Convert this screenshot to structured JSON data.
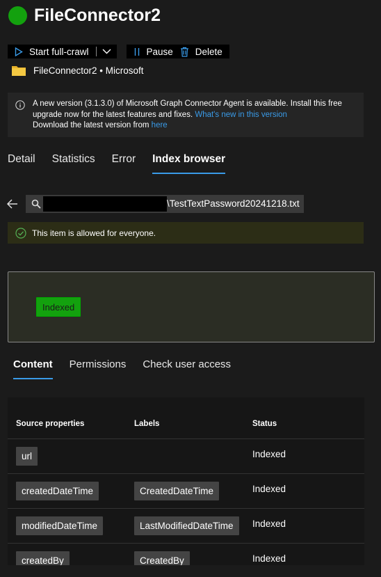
{
  "header": {
    "title": "FileConnector2",
    "status_color": "#13a10e"
  },
  "toolbar": {
    "start_label": "Start full-crawl",
    "pause_label": "Pause",
    "delete_label": "Delete"
  },
  "owner": {
    "text": "FileConnector2 • Microsoft",
    "icon": "folder-icon"
  },
  "banner": {
    "line1": "A new version (3.1.3.0) of Microsoft Graph Connector Agent is available. Install this free upgrade now for the latest features and fixes.",
    "whats_new_link": "What's new in this version",
    "download_text": "Download the latest version from",
    "here_link": "here"
  },
  "tabs": [
    "Detail",
    "Statistics",
    "Error",
    "Index browser"
  ],
  "active_tab": "Index browser",
  "search": {
    "value": "\\TestTextPassword20241218.txt"
  },
  "allowed": {
    "text": "This item is allowed for everyone."
  },
  "index_status": {
    "label": "Indexed"
  },
  "subtabs": [
    "Content",
    "Permissions",
    "Check user access"
  ],
  "table": {
    "headers": [
      "Source properties",
      "Labels",
      "Status"
    ],
    "rows": [
      {
        "property": "url",
        "label": "",
        "status": "Indexed"
      },
      {
        "property": "createdDateTime",
        "label": "CreatedDateTime",
        "status": "Indexed"
      },
      {
        "property": "modifiedDateTime",
        "label": "LastModifiedDateTime",
        "status": "Indexed"
      },
      {
        "property": "createdBy",
        "label": "CreatedBy",
        "status": "Indexed"
      }
    ]
  }
}
